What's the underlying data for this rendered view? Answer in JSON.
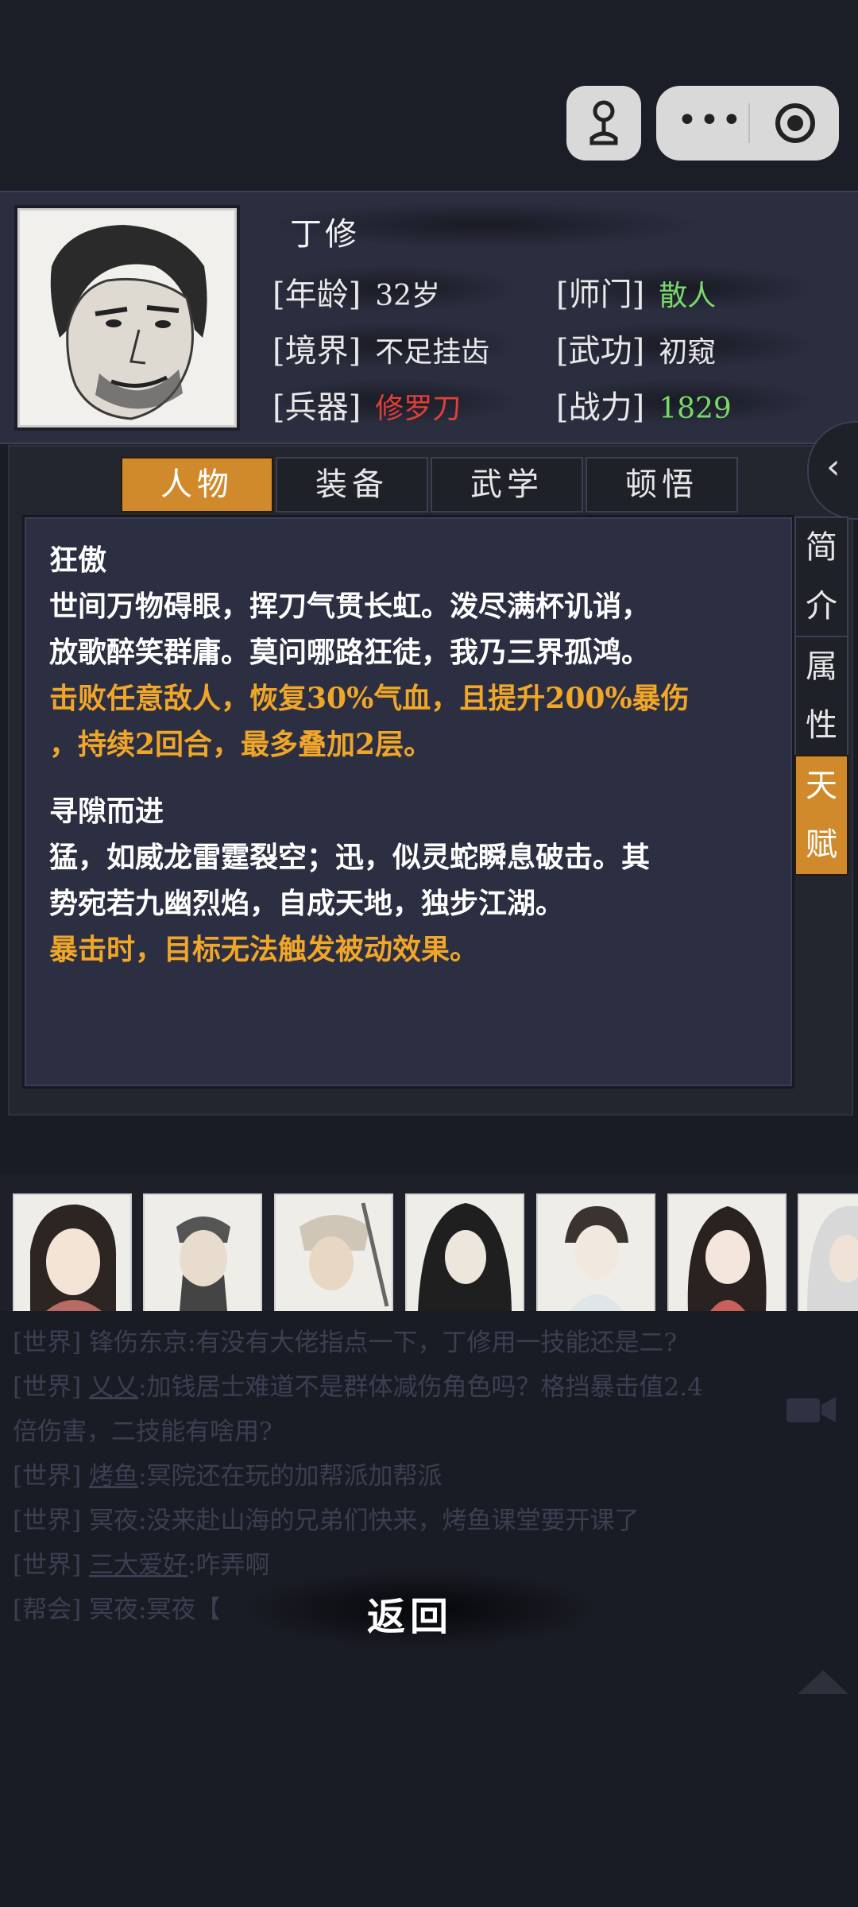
{
  "character": {
    "name": "丁修",
    "attributes": [
      {
        "label": "[年龄]",
        "value": "32岁",
        "color": "#e8e8e8"
      },
      {
        "label": "[师门]",
        "value": "散人",
        "color": "#79d86a"
      },
      {
        "label": "[境界]",
        "value": "不足挂齿",
        "color": "#e8e8e8"
      },
      {
        "label": "[武功]",
        "value": "初窥",
        "color": "#e8e8e8"
      },
      {
        "label": "[兵器]",
        "value": "修罗刀",
        "color": "#e0403a"
      },
      {
        "label": "[战力]",
        "value": "1829",
        "color": "#79d86a"
      }
    ]
  },
  "tabs": [
    "人物",
    "装备",
    "武学",
    "顿悟"
  ],
  "side_tabs": [
    {
      "chars": [
        "简",
        "介"
      ]
    },
    {
      "chars": [
        "属",
        "性"
      ]
    },
    {
      "chars": [
        "天",
        "赋"
      ]
    }
  ],
  "talents": [
    {
      "title": "狂傲",
      "desc_lines": [
        "世间万物碍眼，挥刀气贯长虹。泼尽满杯讥诮，",
        "放歌醉笑群庸。莫问哪路狂徒，我乃三界孤鸿。"
      ],
      "effect_lines": [
        "击败任意敌人，恢复30%气血，且提升200%暴伤",
        "，持续2回合，最多叠加2层。"
      ]
    },
    {
      "title": "寻隙而进",
      "desc_lines": [
        "猛，如威龙雷霆裂空；迅，似灵蛇瞬息破击。其",
        "势宛若九幽烈焰，自成天地，独步江湖。"
      ],
      "effect_lines": [
        "暴击时，目标无法触发被动效果。"
      ]
    }
  ],
  "chat": [
    {
      "channel": "[世界]",
      "user": "锋伤东京",
      "text": ":有没有大佬指点一下，丁修用一技能还是二?"
    },
    {
      "channel": "[世界]",
      "user": "乂乂",
      "text": ":加钱居士难道不是群体减伤角色吗？格挡暴击值2.4"
    },
    {
      "channel": "",
      "user": "",
      "text": "倍伤害，二技能有啥用?"
    },
    {
      "channel": "[世界]",
      "user": "烤鱼",
      "text": ":冥院还在玩的加帮派加帮派"
    },
    {
      "channel": "[世界]",
      "user": "",
      "text": "冥夜:没来赴山海的兄弟们快来，烤鱼课堂要开课了"
    },
    {
      "channel": "[世界]",
      "user": "三大爱好",
      "text": ":咋弄啊"
    },
    {
      "channel": "[帮会]",
      "user": "",
      "text": "冥夜:冥夜【"
    }
  ],
  "back_label": "返回",
  "colors": {
    "accent": "#d18a2b",
    "effect": "#f0a629",
    "green": "#79d86a",
    "red": "#e0403a"
  }
}
